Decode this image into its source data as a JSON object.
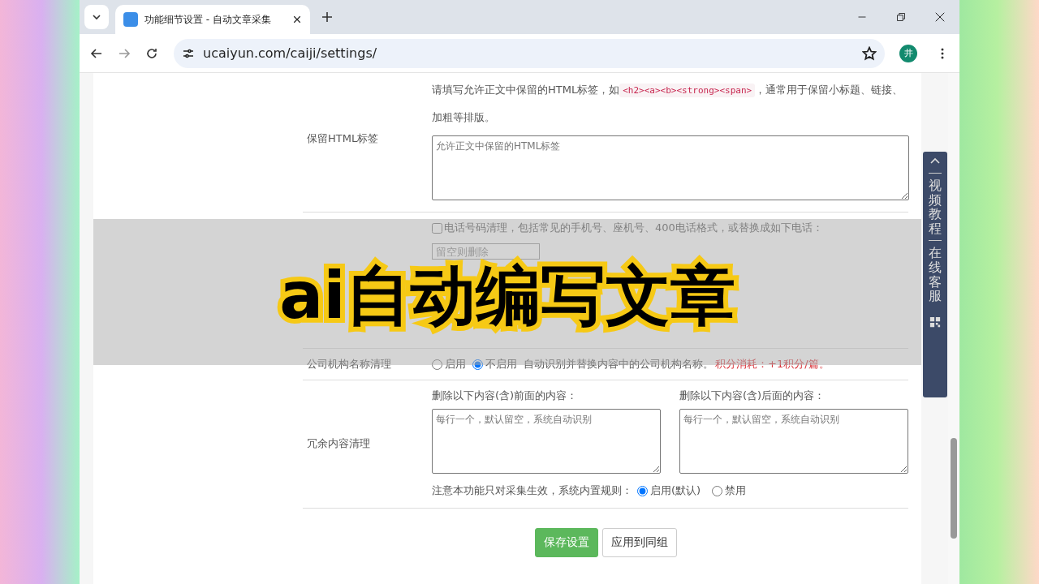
{
  "browser": {
    "tabs": [
      {
        "title": "功能细节设置 - 自动文章采集",
        "selected": true
      }
    ],
    "address": "ucaiyun.com/caiji/settings/",
    "profile_initial": "井"
  },
  "form": {
    "rows": [
      {
        "kind": "textarea",
        "label": "保留HTML标签",
        "hint_before": "请填写允许正文中保留的HTML标签，如",
        "hint_code": "<h2><a><b><strong><span>",
        "hint_after": "，通常用于保留小标题、链接、加粗等排版。",
        "placeholder": "允许正文中保留的HTML标签"
      },
      {
        "kind": "phone",
        "checked": false,
        "text": "电话号码清理，包括常见的手机号、座机号、400电话格式，或替换成如下电话：",
        "placeholder": "留空则删除"
      },
      {
        "kind": "radio",
        "label": "公司机构名称清理",
        "options": [
          {
            "label": "启用",
            "selected": false
          },
          {
            "label": "不启用",
            "selected": true
          }
        ],
        "note": "自动识别并替换内容中的公司机构名称。",
        "cost": "积分消耗：+1积分/篇。"
      },
      {
        "kind": "double",
        "label": "冗余内容清理",
        "fields": [
          {
            "heading": "删除以下内容(含)前面的内容：",
            "placeholder": "每行一个，默认留空，系统自动识别"
          },
          {
            "heading": "删除以下内容(含)后面的内容：",
            "placeholder": "每行一个，默认留空，系统自动识别"
          }
        ],
        "note": "注意本功能只对采集生效，系统内置规则：",
        "options": [
          {
            "label": "启用(默认)",
            "selected": true
          },
          {
            "label": "禁用",
            "selected": false
          }
        ]
      }
    ],
    "buttons": [
      {
        "label": "保存设置",
        "kind": "primary"
      },
      {
        "label": "应用到同组",
        "kind": "default"
      }
    ]
  },
  "side_panel": {
    "items": [
      "视频教程",
      "在线客服"
    ]
  },
  "overlay": {
    "title": "ai自动编写文章"
  }
}
